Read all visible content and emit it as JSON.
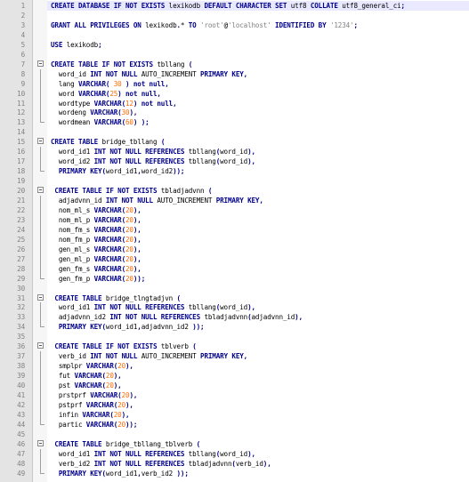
{
  "editor": {
    "colors": {
      "keyword": "#00008b",
      "number": "#ff6a00",
      "string": "#808080",
      "operator": "#000080",
      "text": "#000000",
      "line_number": "#808080",
      "current_line": "#e9e9ff"
    },
    "current_line": 1,
    "lines": [
      {
        "n": "1",
        "fold": "",
        "tokens": [
          [
            "k",
            "CREATE DATABASE IF NOT EXISTS "
          ],
          [
            "t",
            "lexikodb "
          ],
          [
            "k",
            "DEFAULT CHARACTER SET "
          ],
          [
            "t",
            "utf8 "
          ],
          [
            "k",
            "COLLATE "
          ],
          [
            "t",
            "utf8_general_ci"
          ],
          [
            "o",
            ";"
          ]
        ]
      },
      {
        "n": "2",
        "fold": "",
        "tokens": []
      },
      {
        "n": "3",
        "fold": "",
        "tokens": [
          [
            "k",
            "GRANT ALL PRIVILEGES ON "
          ],
          [
            "t",
            "lexikodb"
          ],
          [
            "o",
            "."
          ],
          [
            "t",
            "* "
          ],
          [
            "k",
            "TO "
          ],
          [
            "s",
            "'root'"
          ],
          [
            "t",
            "@"
          ],
          [
            "s",
            "'localhost' "
          ],
          [
            "k",
            "IDENTIFIED BY "
          ],
          [
            "s",
            "'1234'"
          ],
          [
            "o",
            ";"
          ]
        ]
      },
      {
        "n": "4",
        "fold": "",
        "tokens": []
      },
      {
        "n": "5",
        "fold": "",
        "tokens": [
          [
            "k",
            "USE "
          ],
          [
            "t",
            "lexikodb"
          ],
          [
            "o",
            ";"
          ]
        ]
      },
      {
        "n": "6",
        "fold": "",
        "tokens": []
      },
      {
        "n": "7",
        "fold": "start",
        "tokens": [
          [
            "k",
            "CREATE TABLE IF NOT EXISTS "
          ],
          [
            "t",
            "tbllang "
          ],
          [
            "o",
            "("
          ]
        ]
      },
      {
        "n": "8",
        "fold": "mid",
        "tokens": [
          [
            "t",
            "  word_id "
          ],
          [
            "k",
            "INT NOT NULL "
          ],
          [
            "t",
            "AUTO_INCREMENT "
          ],
          [
            "k",
            "PRIMARY KEY"
          ],
          [
            "o",
            ","
          ]
        ]
      },
      {
        "n": "9",
        "fold": "mid",
        "tokens": [
          [
            "t",
            "  lang "
          ],
          [
            "k",
            "VARCHAR"
          ],
          [
            "o",
            "( "
          ],
          [
            "n",
            "30"
          ],
          [
            "o",
            " ) "
          ],
          [
            "k",
            "not null"
          ],
          [
            "o",
            ","
          ]
        ]
      },
      {
        "n": "10",
        "fold": "mid",
        "tokens": [
          [
            "t",
            "  word "
          ],
          [
            "k",
            "VARCHAR"
          ],
          [
            "o",
            "("
          ],
          [
            "n",
            "25"
          ],
          [
            "o",
            ") "
          ],
          [
            "k",
            "not null"
          ],
          [
            "o",
            ","
          ]
        ]
      },
      {
        "n": "11",
        "fold": "mid",
        "tokens": [
          [
            "t",
            "  wordtype "
          ],
          [
            "k",
            "VARCHAR"
          ],
          [
            "o",
            "("
          ],
          [
            "n",
            "12"
          ],
          [
            "o",
            ") "
          ],
          [
            "k",
            "not null"
          ],
          [
            "o",
            ","
          ]
        ]
      },
      {
        "n": "12",
        "fold": "mid",
        "tokens": [
          [
            "t",
            "  wordeng "
          ],
          [
            "k",
            "VARCHAR"
          ],
          [
            "o",
            "("
          ],
          [
            "n",
            "30"
          ],
          [
            "o",
            "),"
          ]
        ]
      },
      {
        "n": "13",
        "fold": "end",
        "tokens": [
          [
            "t",
            "  wordmean "
          ],
          [
            "k",
            "VARCHAR"
          ],
          [
            "o",
            "("
          ],
          [
            "n",
            "60"
          ],
          [
            "o",
            ") );"
          ]
        ]
      },
      {
        "n": "14",
        "fold": "",
        "tokens": []
      },
      {
        "n": "15",
        "fold": "start",
        "tokens": [
          [
            "k",
            "CREATE TABLE "
          ],
          [
            "t",
            "bridge_tbllang "
          ],
          [
            "o",
            "("
          ]
        ]
      },
      {
        "n": "16",
        "fold": "mid",
        "tokens": [
          [
            "t",
            "  word_id1 "
          ],
          [
            "k",
            "INT NOT NULL REFERENCES "
          ],
          [
            "t",
            "tbllang"
          ],
          [
            "o",
            "("
          ],
          [
            "t",
            "word_id"
          ],
          [
            "o",
            "),"
          ]
        ]
      },
      {
        "n": "17",
        "fold": "mid",
        "tokens": [
          [
            "t",
            "  word_id2 "
          ],
          [
            "k",
            "INT NOT NULL REFERENCES "
          ],
          [
            "t",
            "tbllang"
          ],
          [
            "o",
            "("
          ],
          [
            "t",
            "word_id"
          ],
          [
            "o",
            "),"
          ]
        ]
      },
      {
        "n": "18",
        "fold": "end",
        "tokens": [
          [
            "t",
            "  "
          ],
          [
            "k",
            "PRIMARY KEY"
          ],
          [
            "o",
            "("
          ],
          [
            "t",
            "word_id1"
          ],
          [
            "o",
            ","
          ],
          [
            "t",
            "word_id2"
          ],
          [
            "o",
            "));"
          ]
        ]
      },
      {
        "n": "19",
        "fold": "",
        "tokens": []
      },
      {
        "n": "20",
        "fold": "start",
        "tokens": [
          [
            "t",
            " "
          ],
          [
            "k",
            "CREATE TABLE IF NOT EXISTS "
          ],
          [
            "t",
            "tbladjadvnn "
          ],
          [
            "o",
            "("
          ]
        ]
      },
      {
        "n": "21",
        "fold": "mid",
        "tokens": [
          [
            "t",
            "  adjadvnn_id "
          ],
          [
            "k",
            "INT NOT NULL "
          ],
          [
            "t",
            "AUTO_INCREMENT "
          ],
          [
            "k",
            "PRIMARY KEY"
          ],
          [
            "o",
            ","
          ]
        ]
      },
      {
        "n": "22",
        "fold": "mid",
        "tokens": [
          [
            "t",
            "  nom_ml_s "
          ],
          [
            "k",
            "VARCHAR"
          ],
          [
            "o",
            "("
          ],
          [
            "n",
            "20"
          ],
          [
            "o",
            "),"
          ]
        ]
      },
      {
        "n": "23",
        "fold": "mid",
        "tokens": [
          [
            "t",
            "  nom_ml_p "
          ],
          [
            "k",
            "VARCHAR"
          ],
          [
            "o",
            "("
          ],
          [
            "n",
            "20"
          ],
          [
            "o",
            "),"
          ]
        ]
      },
      {
        "n": "24",
        "fold": "mid",
        "tokens": [
          [
            "t",
            "  nom_fm_s "
          ],
          [
            "k",
            "VARCHAR"
          ],
          [
            "o",
            "("
          ],
          [
            "n",
            "20"
          ],
          [
            "o",
            "),"
          ]
        ]
      },
      {
        "n": "25",
        "fold": "mid",
        "tokens": [
          [
            "t",
            "  nom_fm_p "
          ],
          [
            "k",
            "VARCHAR"
          ],
          [
            "o",
            "("
          ],
          [
            "n",
            "20"
          ],
          [
            "o",
            "),"
          ]
        ]
      },
      {
        "n": "26",
        "fold": "mid",
        "tokens": [
          [
            "t",
            "  gen_ml_s "
          ],
          [
            "k",
            "VARCHAR"
          ],
          [
            "o",
            "("
          ],
          [
            "n",
            "20"
          ],
          [
            "o",
            "),"
          ]
        ]
      },
      {
        "n": "27",
        "fold": "mid",
        "tokens": [
          [
            "t",
            "  gen_ml_p "
          ],
          [
            "k",
            "VARCHAR"
          ],
          [
            "o",
            "("
          ],
          [
            "n",
            "20"
          ],
          [
            "o",
            "),"
          ]
        ]
      },
      {
        "n": "28",
        "fold": "mid",
        "tokens": [
          [
            "t",
            "  gen_fm_s "
          ],
          [
            "k",
            "VARCHAR"
          ],
          [
            "o",
            "("
          ],
          [
            "n",
            "20"
          ],
          [
            "o",
            "),"
          ]
        ]
      },
      {
        "n": "29",
        "fold": "end",
        "tokens": [
          [
            "t",
            "  gen_fm_p "
          ],
          [
            "k",
            "VARCHAR"
          ],
          [
            "o",
            "("
          ],
          [
            "n",
            "20"
          ],
          [
            "o",
            "));"
          ]
        ]
      },
      {
        "n": "30",
        "fold": "",
        "tokens": []
      },
      {
        "n": "31",
        "fold": "start",
        "tokens": [
          [
            "t",
            " "
          ],
          [
            "k",
            "CREATE TABLE "
          ],
          [
            "t",
            "bridge_tlngtadjvn "
          ],
          [
            "o",
            "("
          ]
        ]
      },
      {
        "n": "32",
        "fold": "mid",
        "tokens": [
          [
            "t",
            "  word_id1 "
          ],
          [
            "k",
            "INT NOT NULL REFERENCES "
          ],
          [
            "t",
            "tbllang"
          ],
          [
            "o",
            "("
          ],
          [
            "t",
            "word_id"
          ],
          [
            "o",
            "),"
          ]
        ]
      },
      {
        "n": "33",
        "fold": "mid",
        "tokens": [
          [
            "t",
            "  adjadvnn_id2 "
          ],
          [
            "k",
            "INT NOT NULL REFERENCES "
          ],
          [
            "t",
            "tbladjadvnn"
          ],
          [
            "o",
            "("
          ],
          [
            "t",
            "adjadvnn_id"
          ],
          [
            "o",
            "),"
          ]
        ]
      },
      {
        "n": "34",
        "fold": "end",
        "tokens": [
          [
            "t",
            "  "
          ],
          [
            "k",
            "PRIMARY KEY"
          ],
          [
            "o",
            "("
          ],
          [
            "t",
            "word_id1"
          ],
          [
            "o",
            ","
          ],
          [
            "t",
            "adjadvnn_id2 "
          ],
          [
            "o",
            "));"
          ]
        ]
      },
      {
        "n": "35",
        "fold": "",
        "tokens": []
      },
      {
        "n": "36",
        "fold": "start",
        "tokens": [
          [
            "t",
            " "
          ],
          [
            "k",
            "CREATE TABLE IF NOT EXISTS "
          ],
          [
            "t",
            "tblverb "
          ],
          [
            "o",
            "("
          ]
        ]
      },
      {
        "n": "37",
        "fold": "mid",
        "tokens": [
          [
            "t",
            "  verb_id "
          ],
          [
            "k",
            "INT NOT NULL "
          ],
          [
            "t",
            "AUTO_INCREMENT "
          ],
          [
            "k",
            "PRIMARY KEY"
          ],
          [
            "o",
            ","
          ]
        ]
      },
      {
        "n": "38",
        "fold": "mid",
        "tokens": [
          [
            "t",
            "  smplpr "
          ],
          [
            "k",
            "VARCHAR"
          ],
          [
            "o",
            "("
          ],
          [
            "n",
            "20"
          ],
          [
            "o",
            "),"
          ]
        ]
      },
      {
        "n": "39",
        "fold": "mid",
        "tokens": [
          [
            "t",
            "  fut "
          ],
          [
            "k",
            "VARCHAR"
          ],
          [
            "o",
            "("
          ],
          [
            "n",
            "20"
          ],
          [
            "o",
            "),"
          ]
        ]
      },
      {
        "n": "40",
        "fold": "mid",
        "tokens": [
          [
            "t",
            "  pst "
          ],
          [
            "k",
            "VARCHAR"
          ],
          [
            "o",
            "("
          ],
          [
            "n",
            "20"
          ],
          [
            "o",
            "),"
          ]
        ]
      },
      {
        "n": "41",
        "fold": "mid",
        "tokens": [
          [
            "t",
            "  prstprf "
          ],
          [
            "k",
            "VARCHAR"
          ],
          [
            "o",
            "("
          ],
          [
            "n",
            "20"
          ],
          [
            "o",
            "),"
          ]
        ]
      },
      {
        "n": "42",
        "fold": "mid",
        "tokens": [
          [
            "t",
            "  pstprf "
          ],
          [
            "k",
            "VARCHAR"
          ],
          [
            "o",
            "("
          ],
          [
            "n",
            "20"
          ],
          [
            "o",
            "),"
          ]
        ]
      },
      {
        "n": "43",
        "fold": "mid",
        "tokens": [
          [
            "t",
            "  infin "
          ],
          [
            "k",
            "VARCHAR"
          ],
          [
            "o",
            "("
          ],
          [
            "n",
            "20"
          ],
          [
            "o",
            "),"
          ]
        ]
      },
      {
        "n": "44",
        "fold": "end",
        "tokens": [
          [
            "t",
            "  partic "
          ],
          [
            "k",
            "VARCHAR"
          ],
          [
            "o",
            "("
          ],
          [
            "n",
            "20"
          ],
          [
            "o",
            "));"
          ]
        ]
      },
      {
        "n": "45",
        "fold": "",
        "tokens": []
      },
      {
        "n": "46",
        "fold": "start",
        "tokens": [
          [
            "t",
            " "
          ],
          [
            "k",
            "CREATE TABLE "
          ],
          [
            "t",
            "bridge_tbllang_tblverb "
          ],
          [
            "o",
            "("
          ]
        ]
      },
      {
        "n": "47",
        "fold": "mid",
        "tokens": [
          [
            "t",
            "  word_id1 "
          ],
          [
            "k",
            "INT NOT NULL REFERENCES "
          ],
          [
            "t",
            "tbllang"
          ],
          [
            "o",
            "("
          ],
          [
            "t",
            "word_id"
          ],
          [
            "o",
            "),"
          ]
        ]
      },
      {
        "n": "48",
        "fold": "mid",
        "tokens": [
          [
            "t",
            "  verb_id2 "
          ],
          [
            "k",
            "INT NOT NULL REFERENCES "
          ],
          [
            "t",
            "tbladjadvnn"
          ],
          [
            "o",
            "("
          ],
          [
            "t",
            "verb_id"
          ],
          [
            "o",
            "),"
          ]
        ]
      },
      {
        "n": "49",
        "fold": "end",
        "tokens": [
          [
            "t",
            "  "
          ],
          [
            "k",
            "PRIMARY KEY"
          ],
          [
            "o",
            "("
          ],
          [
            "t",
            "word_id1"
          ],
          [
            "o",
            ","
          ],
          [
            "t",
            "verb_id2 "
          ],
          [
            "o",
            "));"
          ]
        ]
      }
    ]
  }
}
